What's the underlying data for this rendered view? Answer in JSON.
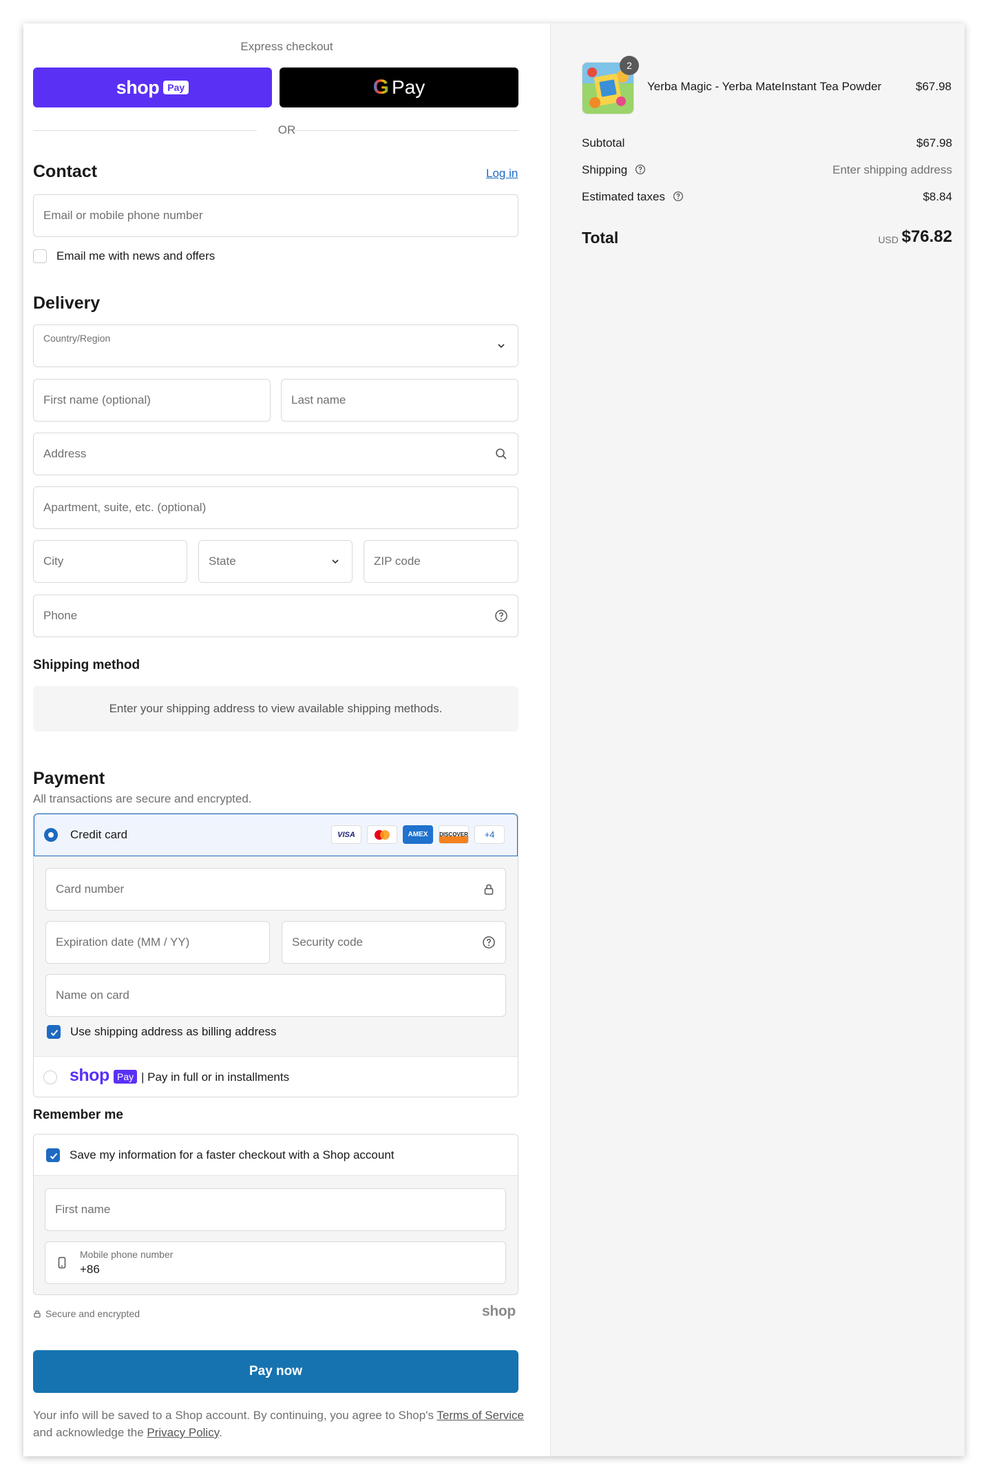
{
  "express": {
    "title": "Express checkout",
    "shop_word": "shop",
    "pay_badge": "Pay",
    "gpay_g": "G",
    "gpay_label": "Pay",
    "or": "OR"
  },
  "contact": {
    "title": "Contact",
    "login": "Log in",
    "email_placeholder": "Email or mobile phone number",
    "news_label": "Email me with news and offers"
  },
  "delivery": {
    "title": "Delivery",
    "country_label": "Country/Region",
    "first_name": "First name (optional)",
    "last_name": "Last name",
    "address": "Address",
    "apartment": "Apartment, suite, etc. (optional)",
    "city": "City",
    "state": "State",
    "zip": "ZIP code",
    "phone": "Phone"
  },
  "shipping_method": {
    "title": "Shipping method",
    "notice": "Enter your shipping address to view available shipping methods."
  },
  "payment": {
    "title": "Payment",
    "subtitle": "All transactions are secure and encrypted.",
    "credit_card": "Credit card",
    "logos": {
      "visa": "VISA",
      "amex": "AMEX",
      "discover": "DISCOVER",
      "more": "+4"
    },
    "card_number": "Card number",
    "expiration": "Expiration date (MM / YY)",
    "security_code": "Security code",
    "name_on_card": "Name on card",
    "billing_same": "Use shipping address as billing address",
    "shop_word": "shop",
    "pay_badge": "Pay",
    "installments": "| Pay in full or in installments"
  },
  "remember": {
    "title": "Remember me",
    "save_label": "Save my information for a faster checkout with a Shop account",
    "first_name": "First name",
    "mobile_label": "Mobile phone number",
    "mobile_value": "+86",
    "secure": "Secure and encrypted",
    "shop_logo": "shop"
  },
  "pay_button": "Pay now",
  "legal": {
    "part1": "Your info will be saved to a Shop account. By continuing, you agree to Shop's ",
    "terms": "Terms of Service",
    "part2": "and acknowledge the ",
    "privacy": "Privacy Policy",
    "end": "."
  },
  "summary": {
    "product": {
      "name": "Yerba Magic - Yerba MateInstant Tea Powder",
      "price": "$67.98",
      "quantity": "2"
    },
    "subtotal_label": "Subtotal",
    "subtotal": "$67.98",
    "shipping_label": "Shipping",
    "shipping_value": "Enter shipping address",
    "taxes_label": "Estimated taxes",
    "taxes": "$8.84",
    "total_label": "Total",
    "currency": "USD",
    "total": "$76.82"
  },
  "colors": {
    "shop_purple": "#5a31f4",
    "accent_blue": "#1d6ac1",
    "pay_button": "#1773b0"
  }
}
